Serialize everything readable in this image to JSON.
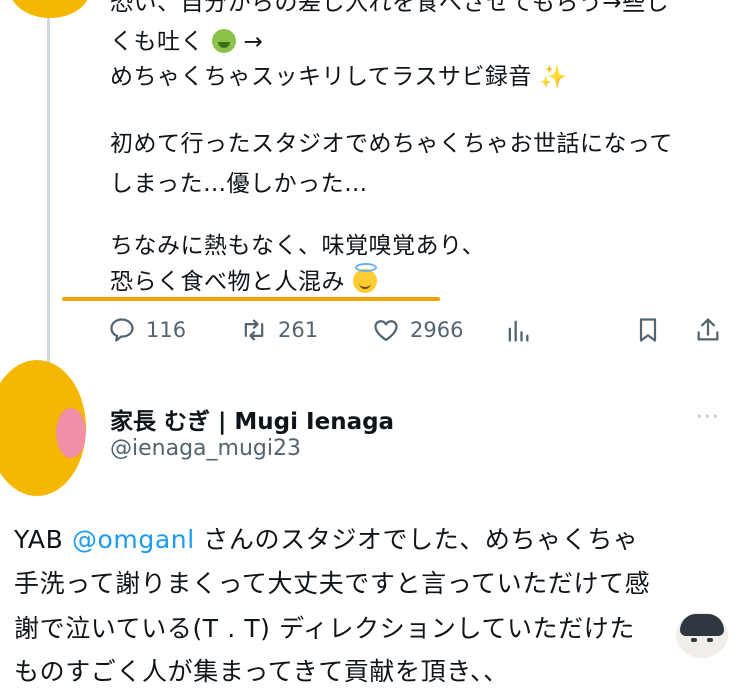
{
  "tweet1": {
    "lines": [
      "恐い、自分からの差し入れを食べさせてもらう→些し",
      "くも吐く",
      "めちゃくちゃスッキリしてラスサビ録音",
      "",
      "初めて行ったスタジオでめちゃくちゃお世話になって",
      "しまった…優しかった…",
      "",
      "ちなみに熱もなく、味覚嗅覚あり、",
      "恐らく食べ物と人混み"
    ],
    "arrow": "→",
    "actions": {
      "reply_count": "116",
      "retweet_count": "261",
      "like_count": "2966"
    }
  },
  "tweet2": {
    "display_name": "家長 むぎ | Mugi Ienaga",
    "handle": "@ienaga_mugi23",
    "more": "···",
    "body": {
      "line1_prefix": "YAB ",
      "line1_mention": "@omganl",
      "line1_suffix": " さんのスタジオでした、めちゃくちゃ",
      "line2": "手洗って謝りまくって大丈夫ですと言っていただけて感",
      "line3": "謝で泣いている(T . T) ディレクションしていただけた",
      "line4": "ものすごく人が集まってきて貢献を頂き、、"
    }
  },
  "colors": {
    "link": "#1d9bf0",
    "secondary_text": "#536471",
    "highlight_underline": "#f2a400",
    "avatar_fill": "#f5b700"
  },
  "icons": [
    "reply-icon",
    "retweet-icon",
    "like-icon",
    "analytics-icon",
    "bookmark-icon",
    "share-icon"
  ]
}
